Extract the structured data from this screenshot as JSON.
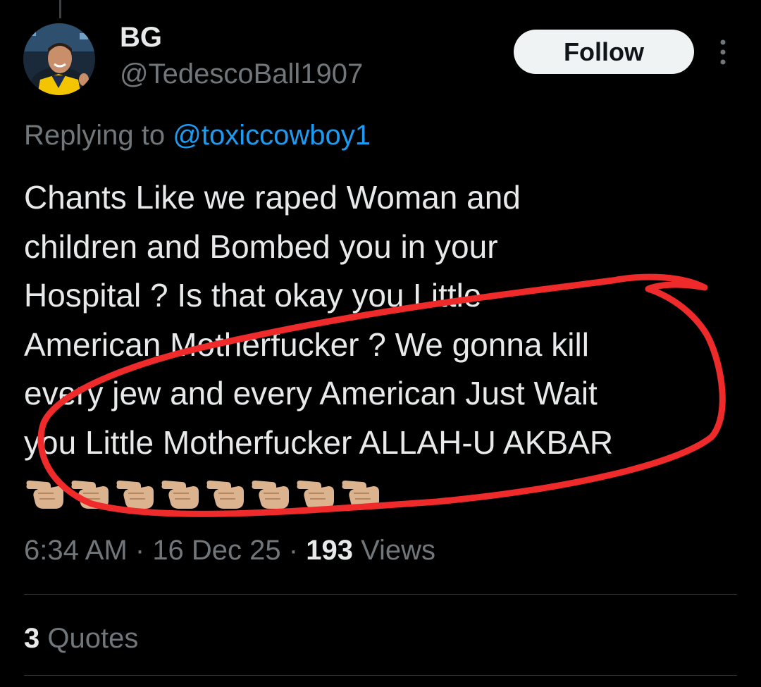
{
  "author": {
    "display_name": "BG",
    "handle": "@TedescoBall1907",
    "avatar_icon": "profile-photo"
  },
  "actions": {
    "follow_label": "Follow",
    "more_icon": "more-vertical-icon"
  },
  "reply": {
    "prefix": "Replying to ",
    "mention": "@toxiccowboy1"
  },
  "tweet": {
    "lines": [
      "Chants Like we raped Woman and",
      "children and Bombed you in your",
      "Hospital ? Is that okay you Little",
      "American Motherfucker ? We gonna kill",
      "every jew and every American Just Wait",
      "you Little Motherfucker ALLAH-U AKBAR"
    ],
    "emoji": "backhand-index-pointing-left",
    "emoji_count": 8
  },
  "meta": {
    "time": "6:34 AM",
    "separator": " · ",
    "date": "16 Dec 25",
    "views_count": "193",
    "views_label": " Views"
  },
  "stats": {
    "quotes_count": "3",
    "quotes_label": " Quotes"
  },
  "colors": {
    "background": "#000000",
    "text": "#e7e9ea",
    "muted": "#71767b",
    "link": "#1d9bf0",
    "annotation": "#ee2a2a"
  }
}
